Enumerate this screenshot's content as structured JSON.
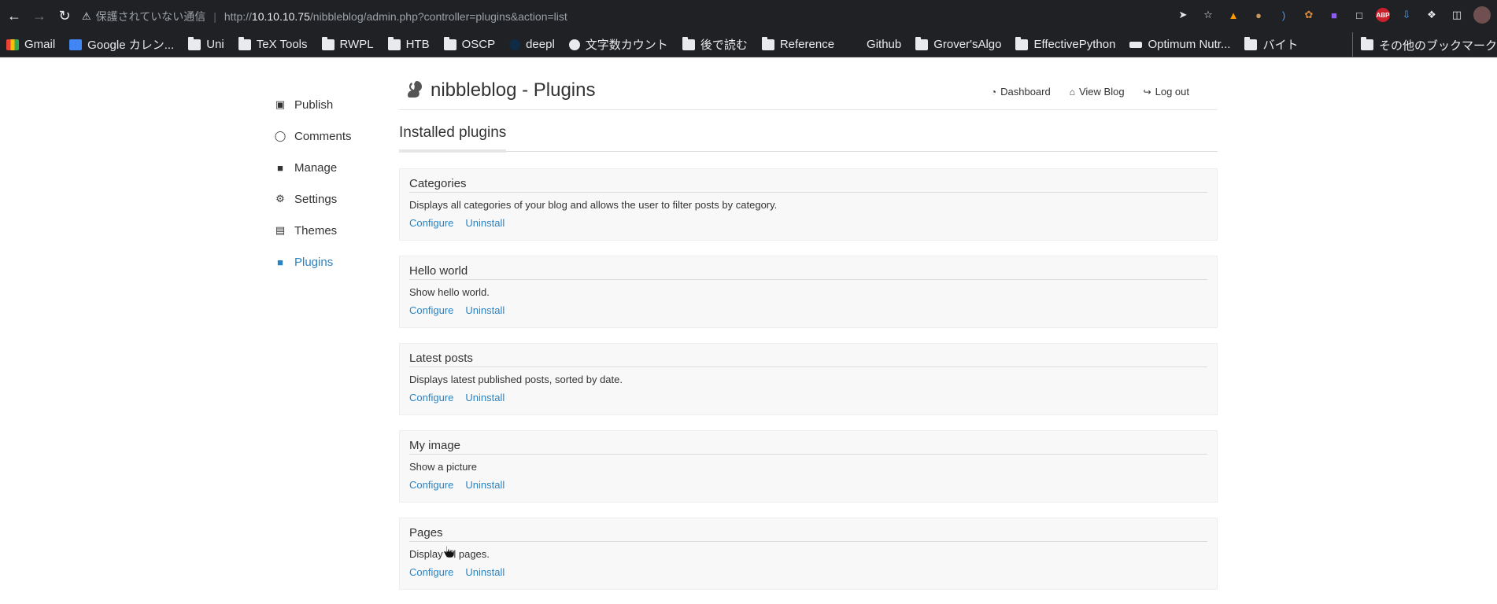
{
  "browser": {
    "security_label": "保護されていない通信",
    "url_prefix": "http://",
    "url_host": "10.10.10.75",
    "url_path": "/nibbleblog/admin.php?controller=plugins&action=list",
    "bookmarks": [
      "Gmail",
      "Google カレン...",
      "Uni",
      "TeX Tools",
      "RWPL",
      "HTB",
      "OSCP",
      "deepl",
      "文字数カウント",
      "後で読む",
      "Reference",
      "Github",
      "Grover'sAlgo",
      "EffectivePython",
      "Optimum Nutr...",
      "バイト"
    ],
    "other_bookmarks": "その他のブックマーク",
    "abp_label": "ABP"
  },
  "sidebar": {
    "items": [
      {
        "label": "Publish",
        "icon": "publish-icon"
      },
      {
        "label": "Comments",
        "icon": "comment-icon"
      },
      {
        "label": "Manage",
        "icon": "folder-icon"
      },
      {
        "label": "Settings",
        "icon": "gear-icon"
      },
      {
        "label": "Themes",
        "icon": "image-icon"
      },
      {
        "label": "Plugins",
        "icon": "folder-open-icon",
        "active": true
      }
    ]
  },
  "header": {
    "title": "nibbleblog - Plugins",
    "links": {
      "dashboard": "Dashboard",
      "view_blog": "View Blog",
      "logout": "Log out"
    }
  },
  "main": {
    "section_title": "Installed plugins",
    "plugins": [
      {
        "name": "Categories",
        "description": "Displays all categories of your blog and allows the user to filter posts by category.",
        "configure": "Configure",
        "uninstall": "Uninstall"
      },
      {
        "name": "Hello world",
        "description": "Show hello world.",
        "configure": "Configure",
        "uninstall": "Uninstall"
      },
      {
        "name": "Latest posts",
        "description": "Displays latest published posts, sorted by date.",
        "configure": "Configure",
        "uninstall": "Uninstall"
      },
      {
        "name": "My image",
        "description": "Show a picture",
        "configure": "Configure",
        "uninstall": "Uninstall"
      },
      {
        "name": "Pages",
        "description": "Display all pages.",
        "configure": "Configure",
        "uninstall": "Uninstall"
      }
    ]
  },
  "colors": {
    "link": "#2a84c4",
    "chrome_bg": "#202124"
  }
}
